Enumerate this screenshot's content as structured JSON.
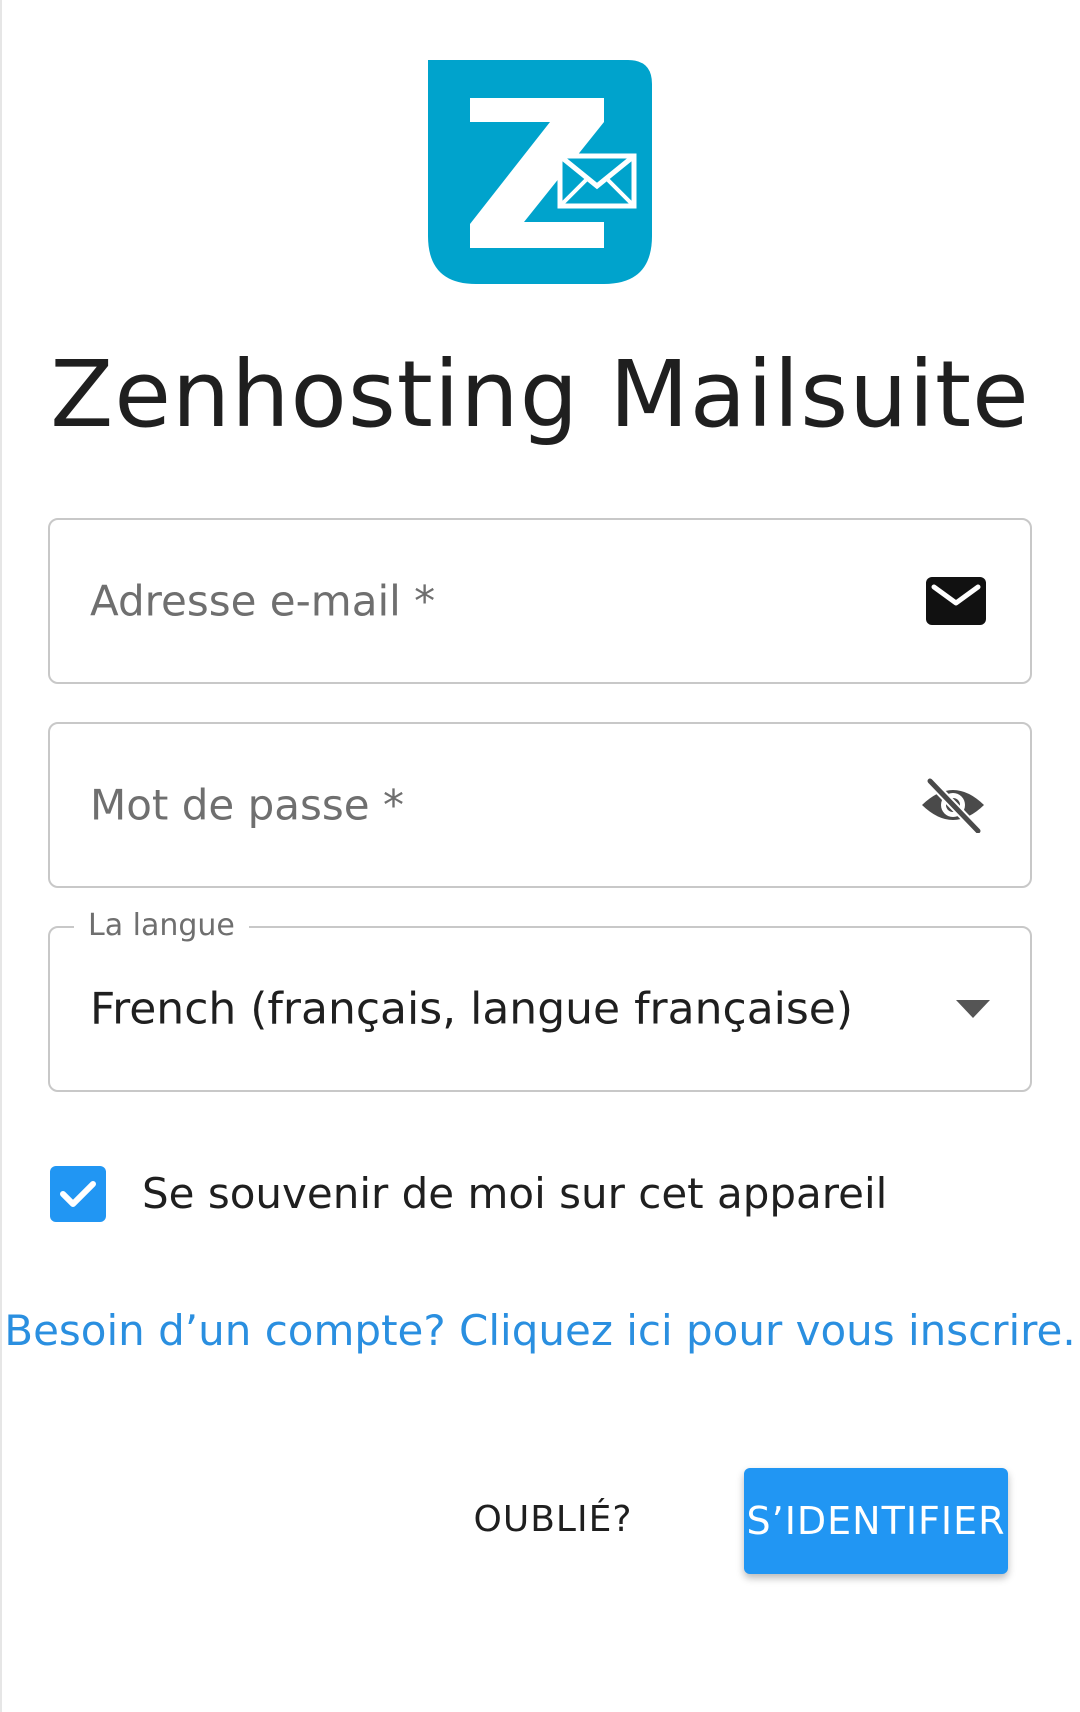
{
  "brand": {
    "title": "Zenhosting Mailsuite",
    "logo_icon": "zenhosting-logo-icon",
    "accent_color": "#00a3cc"
  },
  "form": {
    "email": {
      "placeholder": "Adresse e-mail *",
      "value": "",
      "icon": "envelope-icon"
    },
    "password": {
      "placeholder": "Mot de passe *",
      "value": "",
      "icon": "eye-off-icon"
    },
    "language": {
      "label": "La langue",
      "selected": "French (français, langue française)",
      "icon": "dropdown-arrow-icon"
    },
    "remember_me": {
      "label": "Se souvenir de moi sur cet appareil",
      "checked": true
    }
  },
  "links": {
    "signup": "Besoin d’un compte? Cliquez ici pour vous inscrire."
  },
  "actions": {
    "forgot_label": "OUBLIÉ?",
    "signin_label": "S’IDENTIFIER",
    "primary_color": "#2196f3"
  }
}
